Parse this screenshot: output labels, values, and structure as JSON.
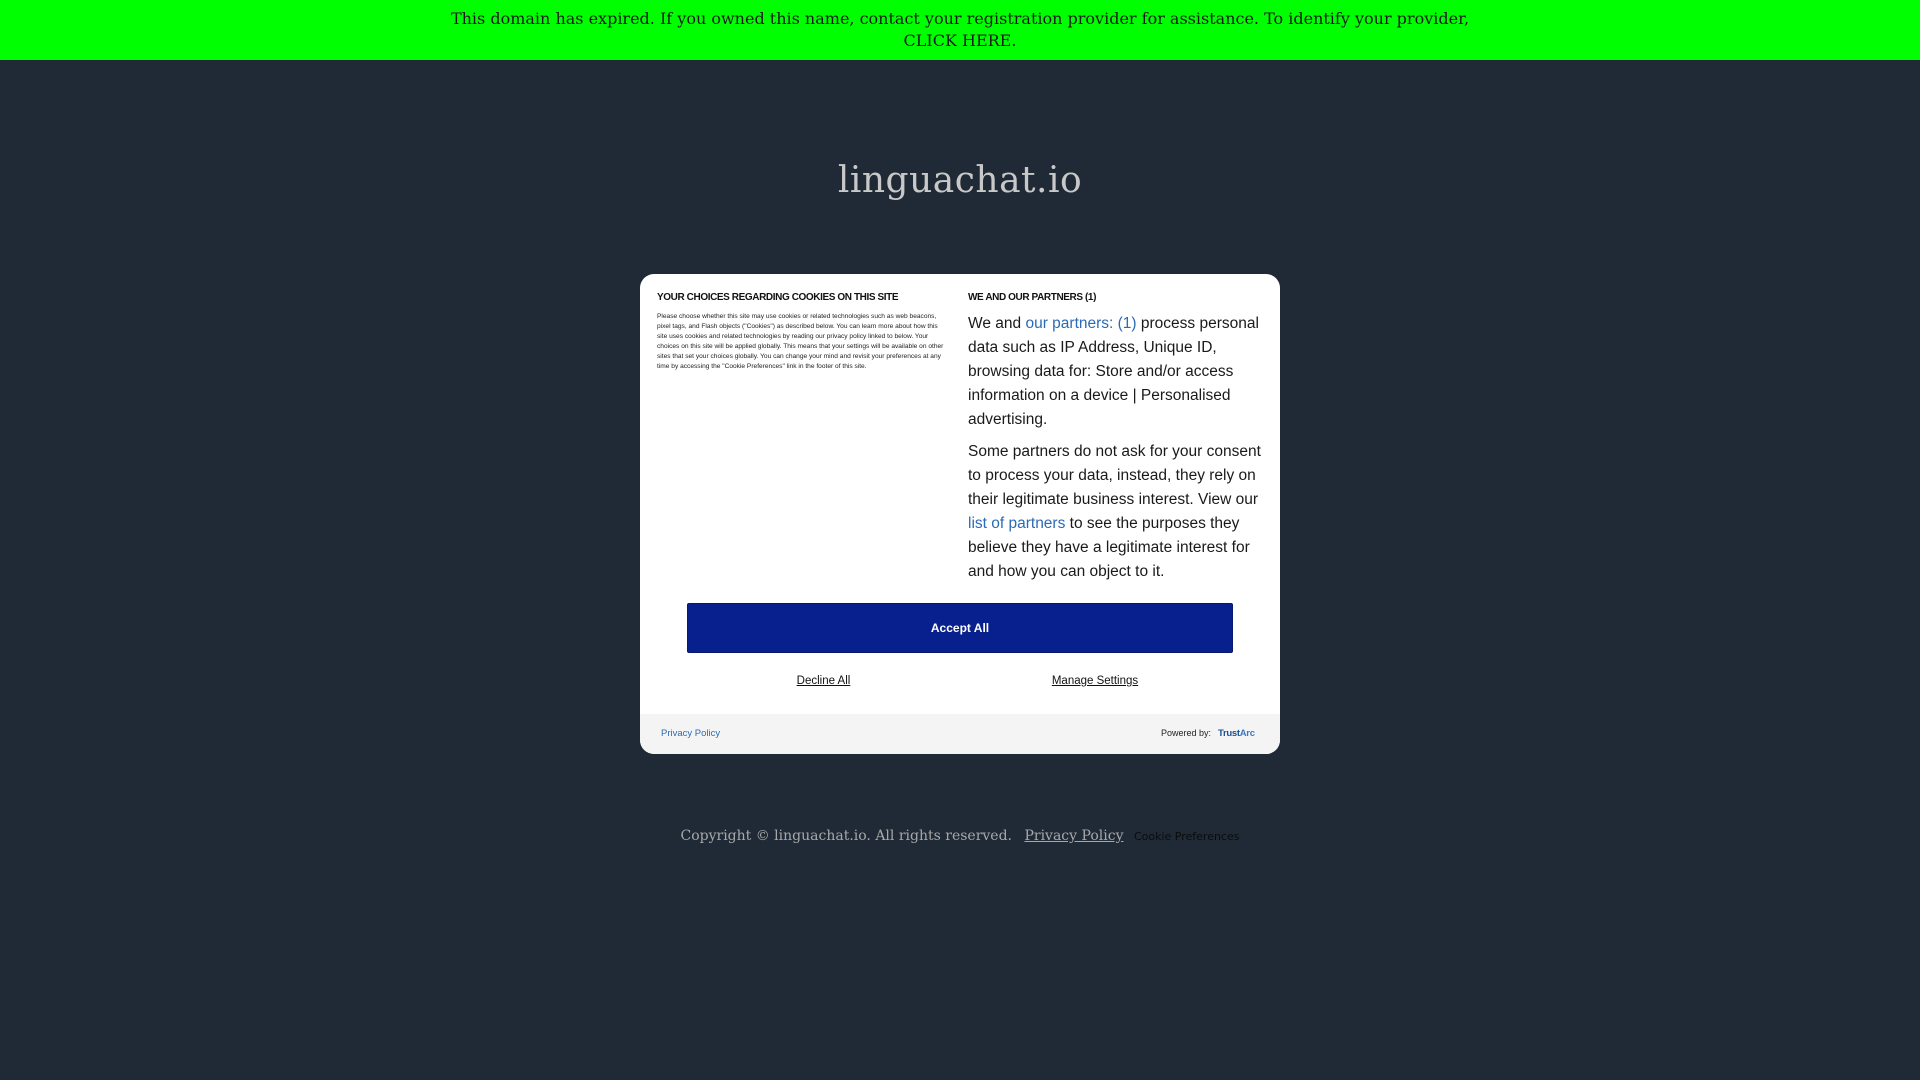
{
  "banner": {
    "message": "This domain has expired. If you owned this name, contact your registration provider for assistance. To identify your provider,",
    "link_label": "CLICK HERE."
  },
  "site": {
    "title": "linguachat.io"
  },
  "cookie_modal": {
    "left": {
      "heading": "YOUR CHOICES REGARDING COOKIES ON THIS SITE",
      "body": "Please choose whether this site may use cookies or related technologies such as web beacons, pixel tags, and Flash objects (\"Cookies\") as described below. You can learn more about how this site uses cookies and related technologies by reading our privacy policy linked to below. Your choices on this site will be applied globally. This means that your settings will be available on other sites that set your choices globally. You can change your mind and revisit your preferences at any time by accessing the \"Cookie Preferences\" link in the footer of this site."
    },
    "right": {
      "heading": "WE AND OUR PARTNERS (1)",
      "p1_prefix": "We and ",
      "p1_link": "our partners: (1)",
      "p1_suffix": " process personal data such as IP Address, Unique ID, browsing data for: Store and/or access information on a device | Personalised advertising.",
      "p2_prefix": "Some partners do not ask for your consent to process your data, instead, they rely on their legitimate business interest. View our ",
      "p2_link": "list of partners",
      "p2_suffix": " to see the purposes they believe they have a legitimate interest for and how you can object to it."
    },
    "accept_label": "Accept All",
    "decline_label": "Decline All",
    "manage_label": "Manage Settings",
    "footer": {
      "privacy_label": "Privacy Policy",
      "powered_by": "Powered by:",
      "brand_trust": "Trust",
      "brand_arc": "Arc"
    }
  },
  "page_footer": {
    "copyright": "Copyright © linguachat.io.  All rights reserved.",
    "privacy_label": "Privacy Policy",
    "cookie_prefs_label": "Cookie Preferences"
  },
  "colors": {
    "banner_bg": "#00ff00",
    "page_bg": "#1f2a36",
    "accept_bg": "#08208d",
    "link": "#2a6bb5"
  }
}
